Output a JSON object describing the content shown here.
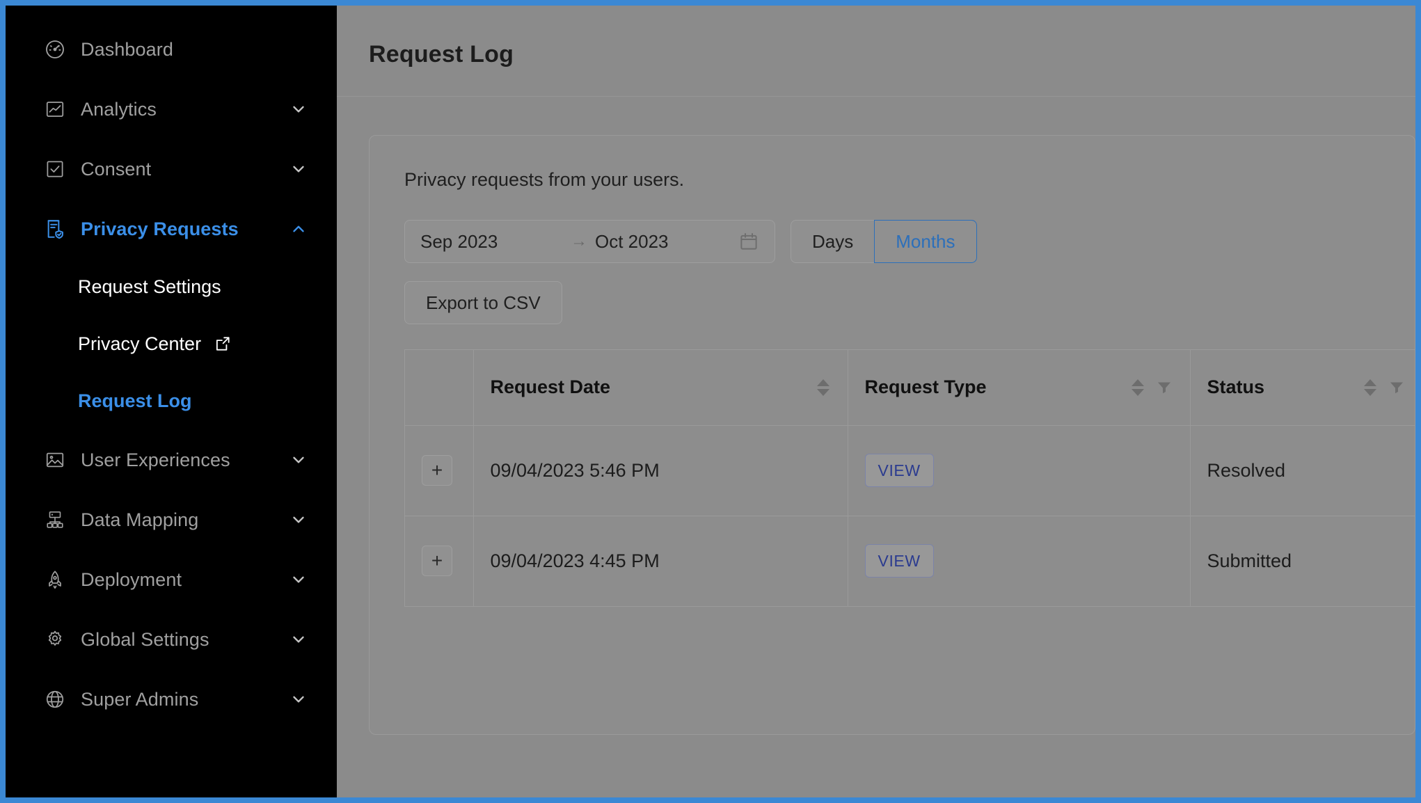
{
  "theme": {
    "frame_border": "#3b88d4",
    "sidebar_bg": "#000000",
    "accent_blue": "#3b8fe8",
    "overlay_gray": "#8b8b8b",
    "link_blue": "#2b3b8f",
    "segment_selected": "#2c6fba"
  },
  "sidebar": {
    "items": [
      {
        "label": "Dashboard",
        "icon": "dashboard-gauge-icon",
        "expandable": false,
        "active": false
      },
      {
        "label": "Analytics",
        "icon": "analytics-chart-icon",
        "expandable": true,
        "active": false,
        "chevron": "chevron-down-icon"
      },
      {
        "label": "Consent",
        "icon": "consent-checkbox-icon",
        "expandable": true,
        "active": false,
        "chevron": "chevron-down-icon"
      },
      {
        "label": "Privacy Requests",
        "icon": "privacy-shield-doc-icon",
        "expandable": true,
        "active": true,
        "chevron": "chevron-up-icon"
      }
    ],
    "sub_items": [
      {
        "label": "Request Settings",
        "current": false,
        "external": false
      },
      {
        "label": "Privacy Center",
        "current": false,
        "external": true,
        "external_icon": "external-link-icon"
      },
      {
        "label": "Request Log",
        "current": true,
        "external": false
      }
    ],
    "items_after": [
      {
        "label": "User Experiences",
        "icon": "image-picture-icon",
        "expandable": true,
        "active": false,
        "chevron": "chevron-down-icon"
      },
      {
        "label": "Data Mapping",
        "icon": "sitemap-icon",
        "expandable": true,
        "active": false,
        "chevron": "chevron-down-icon"
      },
      {
        "label": "Deployment",
        "icon": "rocket-icon",
        "expandable": true,
        "active": false,
        "chevron": "chevron-down-icon"
      },
      {
        "label": "Global Settings",
        "icon": "gear-icon",
        "expandable": true,
        "active": false,
        "chevron": "chevron-down-icon"
      },
      {
        "label": "Super Admins",
        "icon": "globe-icon",
        "expandable": true,
        "active": false,
        "chevron": "chevron-down-icon"
      }
    ]
  },
  "header": {
    "title": "Request Log"
  },
  "card": {
    "description": "Privacy requests from your users.",
    "date_range": {
      "start": "Sep 2023",
      "separator": "→",
      "end": "Oct 2023",
      "calendar_icon": "calendar-icon"
    },
    "granularity": {
      "options": [
        "Days",
        "Months"
      ],
      "selected": "Months"
    },
    "export_label": "Export to CSV"
  },
  "table": {
    "columns": [
      {
        "key": "expand",
        "label": "",
        "sortable": false,
        "filterable": false
      },
      {
        "key": "date",
        "label": "Request Date",
        "sortable": true,
        "filterable": false
      },
      {
        "key": "type",
        "label": "Request Type",
        "sortable": true,
        "filterable": true
      },
      {
        "key": "status",
        "label": "Status",
        "sortable": true,
        "filterable": true
      }
    ],
    "expand_glyph": "+",
    "rows": [
      {
        "date": "09/04/2023 5:46 PM",
        "type_label": "VIEW",
        "status": "Resolved"
      },
      {
        "date": "09/04/2023 4:45 PM",
        "type_label": "VIEW",
        "status": "Submitted"
      }
    ]
  }
}
